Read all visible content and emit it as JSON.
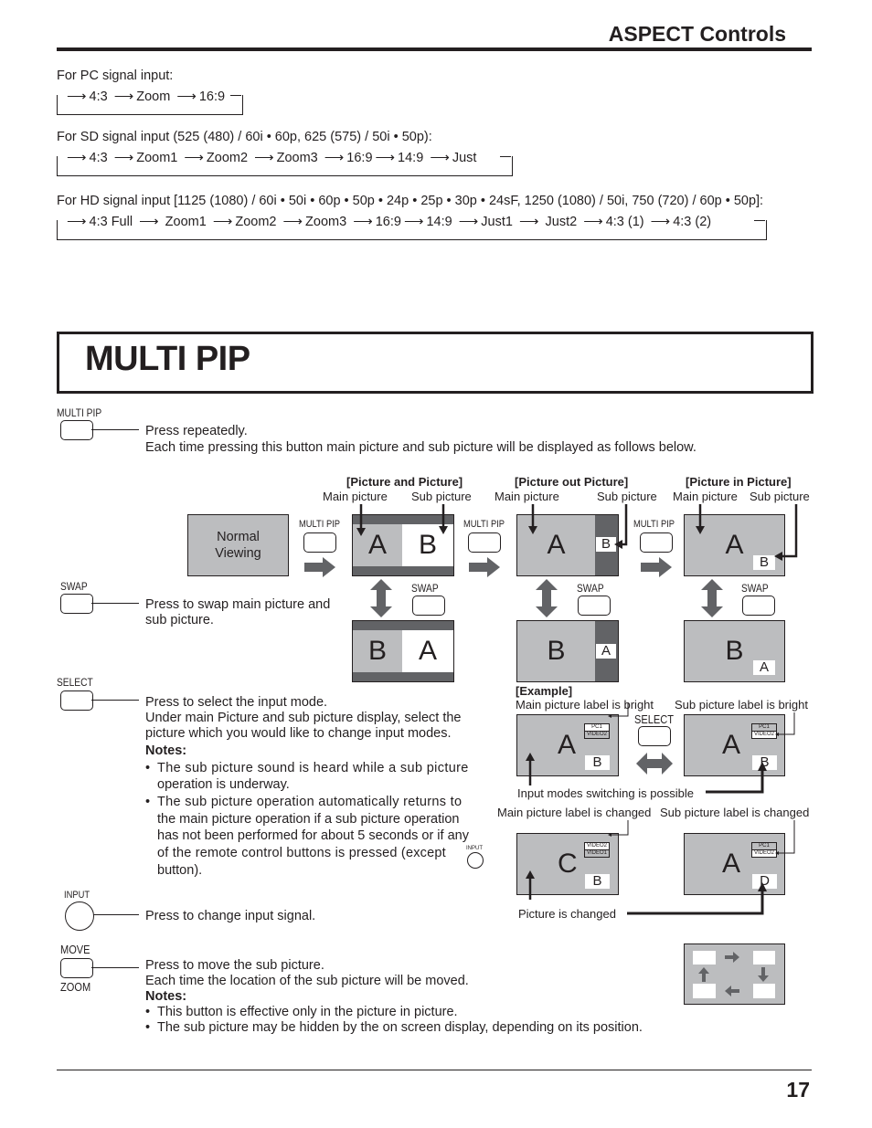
{
  "header": {
    "section_title": "ASPECT Controls"
  },
  "aspect": {
    "pc": {
      "label": "For PC signal input:",
      "sequence": [
        "4:3",
        "Zoom",
        "16:9"
      ]
    },
    "sd": {
      "label": "For SD signal input (525 (480) / 60i • 60p, 625 (575) / 50i • 50p):",
      "sequence": [
        "4:3",
        "Zoom1",
        "Zoom2",
        "Zoom3",
        "16:9",
        "14:9",
        "Just"
      ]
    },
    "hd": {
      "label": "For HD signal input [1125 (1080) / 60i • 50i • 60p • 50p • 24p • 25p • 30p • 24sF, 1250 (1080) / 50i, 750 (720) / 60p • 50p]:",
      "sequence": [
        "4:3 Full",
        "Zoom1",
        "Zoom2",
        "Zoom3",
        "16:9",
        "14:9",
        "Just1",
        "Just2",
        "4:3 (1)",
        "4:3 (2)"
      ]
    }
  },
  "section": {
    "title": "MULTI PIP"
  },
  "buttons": {
    "multipip": {
      "label": "MULTI PIP",
      "desc1": "Press repeatedly.",
      "desc2": "Each time pressing this button main picture and sub picture will be displayed as follows below."
    },
    "swap": {
      "label": "SWAP",
      "desc1": "Press to swap main picture and",
      "desc2": "sub picture."
    },
    "select": {
      "label": "SELECT",
      "desc1": "Press to select the input mode.",
      "desc2": "Under main Picture and sub picture display, select the",
      "desc3": "picture which you would like to change input modes.",
      "notes_label": "Notes:",
      "note1a": "The sub picture sound is heard while a sub picture",
      "note1b": "operation is underway.",
      "note2a": "The sub picture operation automatically returns to",
      "note2b": "the main picture operation if a sub picture operation",
      "note2c": "has not been performed for about 5 seconds or if any",
      "note2d": "of the remote control buttons is pressed (except",
      "note2e": "button).",
      "inline_input_label": "INPUT"
    },
    "input": {
      "label": "INPUT",
      "desc": "Press to change input signal."
    },
    "move": {
      "label_top": "MOVE",
      "label_bottom": "ZOOM",
      "desc1": "Press to move the sub picture.",
      "desc2": "Each time the location of the sub picture will be moved.",
      "notes_label": "Notes:",
      "note1": "This button is effective only in the picture in picture.",
      "note2": "The sub picture may be hidden by the on screen display, depending on its position."
    }
  },
  "diagram": {
    "normal_viewing_1": "Normal",
    "normal_viewing_2": "Viewing",
    "modes": [
      {
        "title": "[Picture and Picture]",
        "main": "Main picture",
        "sub": "Sub picture"
      },
      {
        "title": "[Picture out Picture]",
        "main": "Main picture",
        "sub": "Sub picture"
      },
      {
        "title": "[Picture in Picture]",
        "main": "Main picture",
        "sub": "Sub picture"
      }
    ],
    "letters": {
      "a": "A",
      "b": "B",
      "c": "C",
      "d": "D"
    },
    "multipip_label": "MULTI PIP",
    "swap_label": "SWAP",
    "select_label": "SELECT",
    "example": {
      "title": "[Example]",
      "main_bright": "Main picture label is bright",
      "sub_bright": "Sub picture label is bright",
      "switching": "Input modes switching is possible",
      "main_changed": "Main picture label is changed",
      "sub_changed": "Sub picture label is changed",
      "picture_changed": "Picture is changed",
      "labels": {
        "pc1": "PC1",
        "video2": "VIDEO2",
        "video1": "VIDEO1"
      }
    }
  },
  "footer": {
    "page_number": "17"
  }
}
